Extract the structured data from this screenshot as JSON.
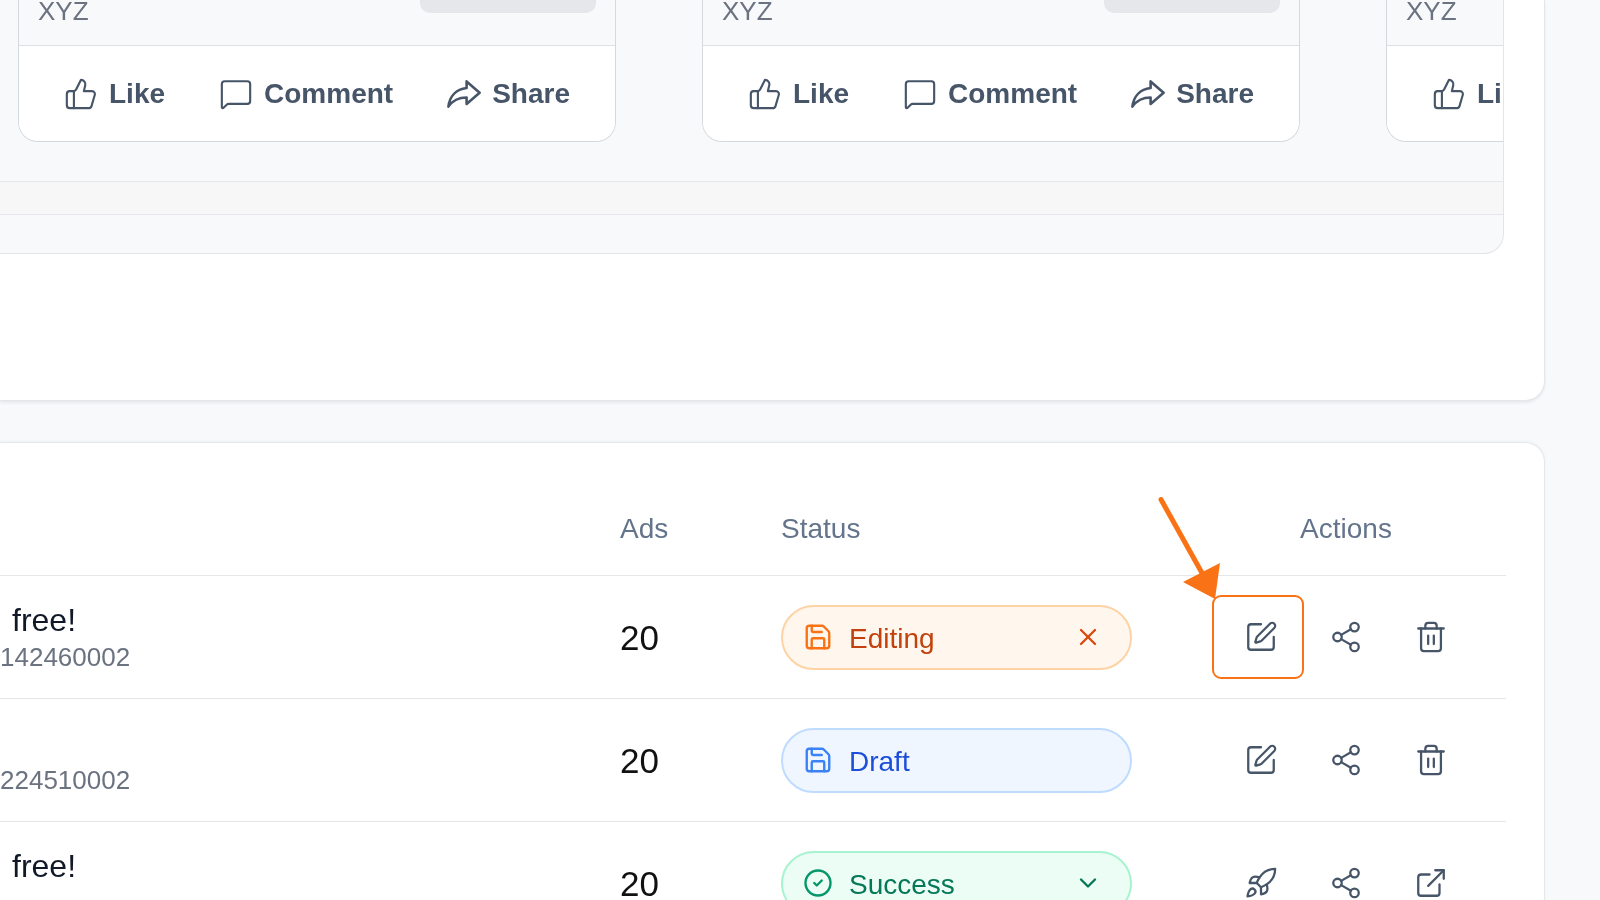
{
  "feed": {
    "cards": [
      {
        "title": "XYZ",
        "menu_button": true,
        "actions": [
          {
            "kind": "like",
            "label": "Like"
          },
          {
            "kind": "comment",
            "label": "Comment"
          },
          {
            "kind": "share",
            "label": "Share"
          }
        ]
      },
      {
        "title": "XYZ",
        "menu_button": true,
        "actions": [
          {
            "kind": "like",
            "label": "Like"
          },
          {
            "kind": "comment",
            "label": "Comment"
          },
          {
            "kind": "share",
            "label": "Share"
          }
        ]
      },
      {
        "title": "XYZ",
        "menu_button": false,
        "actions": [
          {
            "kind": "like",
            "label": "Li"
          }
        ]
      }
    ]
  },
  "table": {
    "columns": [
      "Ads",
      "Status",
      "Actions"
    ],
    "rows": [
      {
        "title": "free!",
        "id": "142460002",
        "ads": "20",
        "status": {
          "kind": "editing",
          "label": "Editing"
        },
        "actions": [
          {
            "kind": "edit",
            "highlighted": true
          },
          {
            "kind": "share",
            "highlighted": false
          },
          {
            "kind": "delete",
            "highlighted": false
          }
        ]
      },
      {
        "id": "224510002",
        "ads": "20",
        "status": {
          "kind": "draft",
          "label": "Draft"
        },
        "actions": [
          {
            "kind": "edit",
            "highlighted": false
          },
          {
            "kind": "share",
            "highlighted": false
          },
          {
            "kind": "delete",
            "highlighted": false
          }
        ]
      },
      {
        "title": "free!",
        "ads": "20",
        "status": {
          "kind": "success",
          "label": "Success"
        },
        "actions": [
          {
            "kind": "launch",
            "highlighted": false
          },
          {
            "kind": "share",
            "highlighted": false
          },
          {
            "kind": "open",
            "highlighted": false
          }
        ]
      }
    ]
  }
}
